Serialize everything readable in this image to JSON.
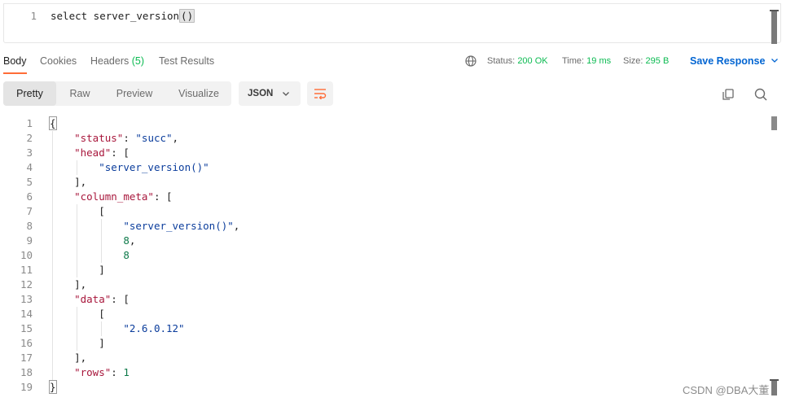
{
  "query_editor": {
    "line_number": "1",
    "text_before": "select server_version",
    "text_paren": "()"
  },
  "response_tabs": {
    "body": "Body",
    "cookies": "Cookies",
    "headers_label": "Headers",
    "headers_count": "(5)",
    "test_results": "Test Results"
  },
  "response_meta": {
    "status_label": "Status:",
    "status_value": "200 OK",
    "time_label": "Time:",
    "time_value": "19 ms",
    "size_label": "Size:",
    "size_value": "295 B",
    "save_response": "Save Response",
    "globe_icon": "globe-icon"
  },
  "view_modes": {
    "pretty": "Pretty",
    "raw": "Raw",
    "preview": "Preview",
    "visualize": "Visualize",
    "active": "Pretty"
  },
  "format_select": {
    "selected": "JSON"
  },
  "icons": [
    "wrap-lines-icon",
    "copy-icon",
    "search-icon",
    "chevron-down-icon"
  ],
  "colors": {
    "accent_orange": "#ff6c37",
    "status_green": "#0cbb52",
    "link_blue": "#0265d2",
    "json_key": "#a8173c",
    "json_string": "#0b3d9c",
    "json_number": "#0e7a4a"
  },
  "response_lines": [
    {
      "n": "1",
      "indent": "",
      "parts": [
        {
          "t": "{",
          "c": "punc"
        }
      ]
    },
    {
      "n": "2",
      "indent": "    ",
      "parts": [
        {
          "t": "\"status\"",
          "c": "key"
        },
        {
          "t": ": ",
          "c": "punc"
        },
        {
          "t": "\"succ\"",
          "c": "str"
        },
        {
          "t": ",",
          "c": "punc"
        }
      ]
    },
    {
      "n": "3",
      "indent": "    ",
      "parts": [
        {
          "t": "\"head\"",
          "c": "key"
        },
        {
          "t": ": [",
          "c": "punc"
        }
      ]
    },
    {
      "n": "4",
      "indent": "        ",
      "parts": [
        {
          "t": "\"server_version()\"",
          "c": "str"
        }
      ]
    },
    {
      "n": "5",
      "indent": "    ",
      "parts": [
        {
          "t": "],",
          "c": "punc"
        }
      ]
    },
    {
      "n": "6",
      "indent": "    ",
      "parts": [
        {
          "t": "\"column_meta\"",
          "c": "key"
        },
        {
          "t": ": [",
          "c": "punc"
        }
      ]
    },
    {
      "n": "7",
      "indent": "        ",
      "parts": [
        {
          "t": "[",
          "c": "punc"
        }
      ]
    },
    {
      "n": "8",
      "indent": "            ",
      "parts": [
        {
          "t": "\"server_version()\"",
          "c": "str"
        },
        {
          "t": ",",
          "c": "punc"
        }
      ]
    },
    {
      "n": "9",
      "indent": "            ",
      "parts": [
        {
          "t": "8",
          "c": "num"
        },
        {
          "t": ",",
          "c": "punc"
        }
      ]
    },
    {
      "n": "10",
      "indent": "            ",
      "parts": [
        {
          "t": "8",
          "c": "num"
        }
      ]
    },
    {
      "n": "11",
      "indent": "        ",
      "parts": [
        {
          "t": "]",
          "c": "punc"
        }
      ]
    },
    {
      "n": "12",
      "indent": "    ",
      "parts": [
        {
          "t": "],",
          "c": "punc"
        }
      ]
    },
    {
      "n": "13",
      "indent": "    ",
      "parts": [
        {
          "t": "\"data\"",
          "c": "key"
        },
        {
          "t": ": [",
          "c": "punc"
        }
      ]
    },
    {
      "n": "14",
      "indent": "        ",
      "parts": [
        {
          "t": "[",
          "c": "punc"
        }
      ]
    },
    {
      "n": "15",
      "indent": "            ",
      "parts": [
        {
          "t": "\"2.6.0.12\"",
          "c": "str"
        }
      ]
    },
    {
      "n": "16",
      "indent": "        ",
      "parts": [
        {
          "t": "]",
          "c": "punc"
        }
      ]
    },
    {
      "n": "17",
      "indent": "    ",
      "parts": [
        {
          "t": "],",
          "c": "punc"
        }
      ]
    },
    {
      "n": "18",
      "indent": "    ",
      "parts": [
        {
          "t": "\"rows\"",
          "c": "key"
        },
        {
          "t": ": ",
          "c": "punc"
        },
        {
          "t": "1",
          "c": "num"
        }
      ]
    },
    {
      "n": "19",
      "indent": "",
      "parts": [
        {
          "t": "}",
          "c": "punc"
        }
      ]
    }
  ],
  "watermark": "CSDN @DBA大董"
}
